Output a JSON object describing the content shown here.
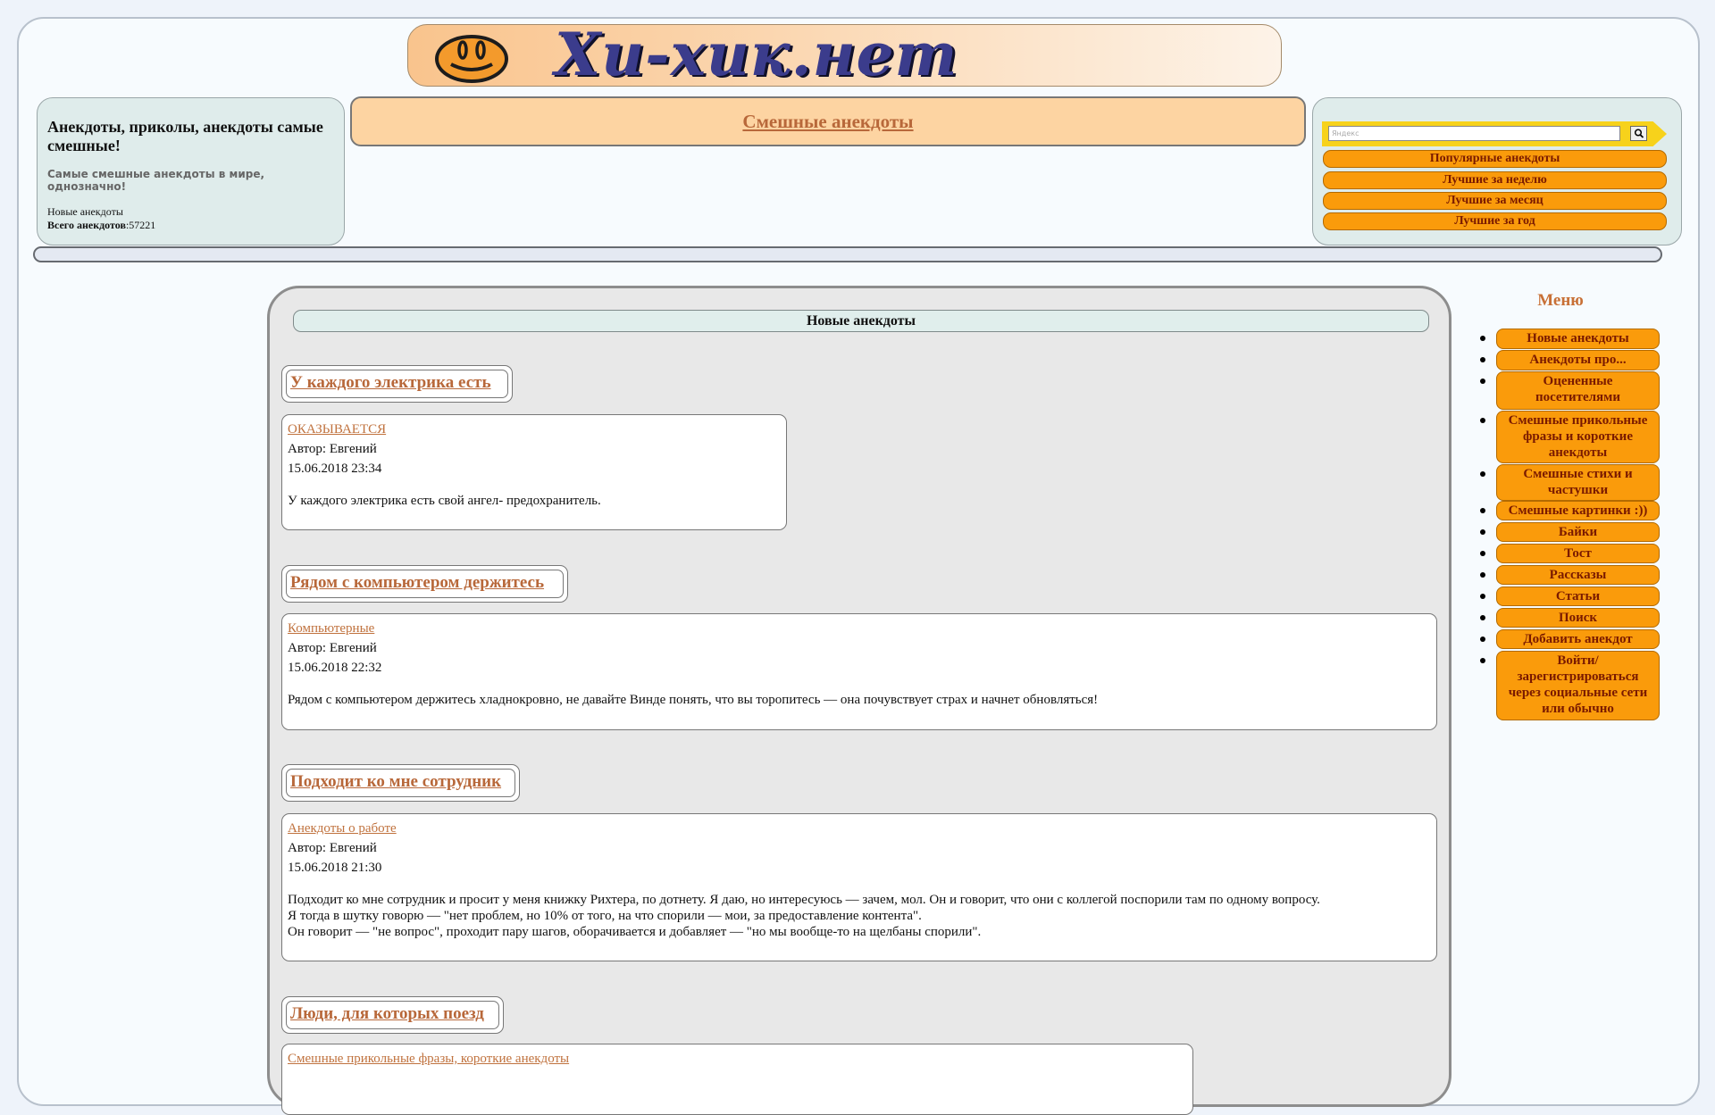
{
  "logo": {
    "text": "Хи-хик.нет"
  },
  "left_info": {
    "title": "Анекдоты, приколы, анекдоты самые смешные!",
    "tagline": "Самые смешные анекдоты в мире, однозначно!",
    "new_link": "Новые анекдоты",
    "total_label": "Всего анекдотов",
    "total_value": ":57221"
  },
  "header": {
    "link": "Смешные анекдоты"
  },
  "search": {
    "placeholder": "Яндекс"
  },
  "right_buttons": [
    "Популярные анекдоты",
    "Лучшие за неделю",
    "Лучшие за месяц",
    "Лучшие за год"
  ],
  "section_title": "Новые анекдоты",
  "jokes": [
    {
      "title": "У каждого электрика есть",
      "category": "ОКАЗЫВАЕТСЯ",
      "author": "Автор: Евгений",
      "date": "15.06.2018 23:34",
      "text": "У каждого электрика есть свой ангел- предохранитель."
    },
    {
      "title": "Рядом с компьютером держитесь",
      "category": "Компьютерные",
      "author": "Автор: Евгений",
      "date": "15.06.2018 22:32",
      "text": "Рядом с компьютером держитесь хладнокровно, не давайте Винде понять, что вы торопитесь — она почувствует страх и начнет обновляться!"
    },
    {
      "title": "Подходит ко мне сотрудник",
      "category": "Анекдоты о работе",
      "author": "Автор: Евгений",
      "date": "15.06.2018 21:30",
      "text": "Подходит ко мне сотрудник и просит у меня книжку Рихтера, по дотнету. Я даю, но интересуюсь — зачем, мол. Он и говорит, что они с коллегой поспорили там по одному вопросу.\nЯ тогда в шутку говорю — \"нет проблем, но 10% от того, на что спорили — мои, за предоставление контента\".\nОн говорит — \"не вопрос\", проходит пару шагов, оборачивается и добавляет — \"но мы вообще-то на щелбаны спорили\"."
    },
    {
      "title": "Люди, для которых поезд",
      "category": "Смешные прикольные фразы, короткие анекдоты",
      "author": "",
      "date": "",
      "text": ""
    }
  ],
  "menu": {
    "title": "Меню",
    "items": [
      "Новые анекдоты",
      "Анекдоты про...",
      "Оцененные посетителями",
      "Смешные прикольные фразы и короткие анекдоты",
      "Смешные стихи и частушки",
      "Смешные картинки :))",
      "Байки",
      "Тост",
      "Рассказы",
      "Статьи",
      "Поиск",
      "Добавить анекдот",
      "Войти/зарегистрироваться через социальные сети или обычно"
    ]
  }
}
